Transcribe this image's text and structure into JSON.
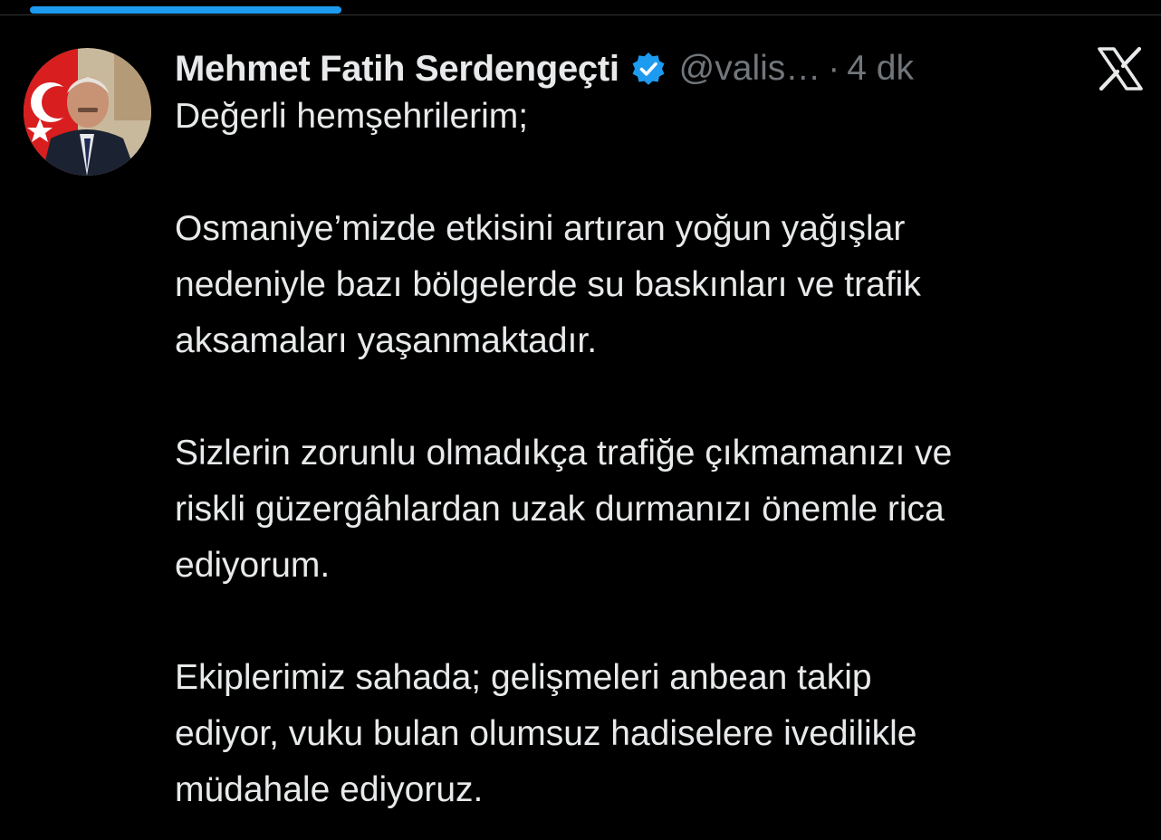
{
  "status": {
    "progress": 0.29
  },
  "tweet": {
    "author": {
      "name": "Mehmet Fatih Serdengeçti",
      "handle": "@valis…",
      "verified": true,
      "avatar": "portrait-avatar"
    },
    "separator": "·",
    "time": "4 dk",
    "platform_icon": "x-logo-icon",
    "paragraphs": [
      "Değerli hemşehrilerim;",
      "Osmaniye’mizde etkisini artıran yoğun yağışlar\nnedeniyle bazı bölgelerde su baskınları ve trafik\naksamaları yaşanmaktadır.",
      "Sizlerin zorunlu olmadıkça trafiğe çıkmamanızı ve\nriskli güzergâhlardan uzak durmanızı önemle rica\nediyorum.",
      "Ekiplerimiz sahada; gelişmeleri anbean takip\nediyor, vuku bulan olumsuz hadiselere ivedilikle\nmüdahale ediyoruz."
    ]
  },
  "colors": {
    "background": "#000000",
    "text": "#e7e9ea",
    "secondary_text": "#71767b",
    "accent": "#1d9bf0"
  }
}
